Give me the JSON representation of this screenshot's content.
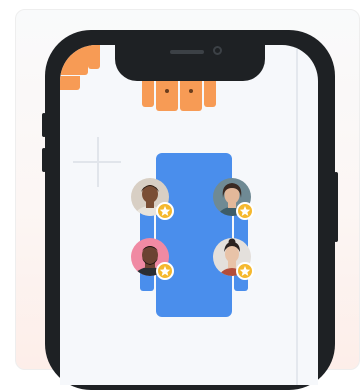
{
  "colors": {
    "card_bg": "#f9fafb",
    "phone_body": "#1e2124",
    "screen_bg": "#f6f8fb",
    "accent_blue": "#4a8eec",
    "accent_orange": "#f79b55",
    "badge_gold": "#f5b82e"
  },
  "icons": [
    "plus-icon",
    "star-icon"
  ],
  "profiles": [
    {
      "id": "top-left",
      "badge_icon": "star-icon",
      "skin": "#7a4e35",
      "hair": "#2a1c15",
      "shirt": "#e9e4dc",
      "bg": "#d8cfc4"
    },
    {
      "id": "top-right",
      "badge_icon": "star-icon",
      "skin": "#e3b89a",
      "hair": "#3a2a22",
      "shirt": "#3d5c68",
      "bg": "#6f8a94"
    },
    {
      "id": "bottom-left",
      "badge_icon": "star-icon",
      "skin": "#6b4332",
      "hair": "#1c1412",
      "shirt": "#2a2e33",
      "bg": "#f08aa3"
    },
    {
      "id": "bottom-right",
      "badge_icon": "star-icon",
      "skin": "#e8c3a8",
      "hair": "#2b2220",
      "shirt": "#b24d3a",
      "bg": "#e4e0dc"
    }
  ]
}
